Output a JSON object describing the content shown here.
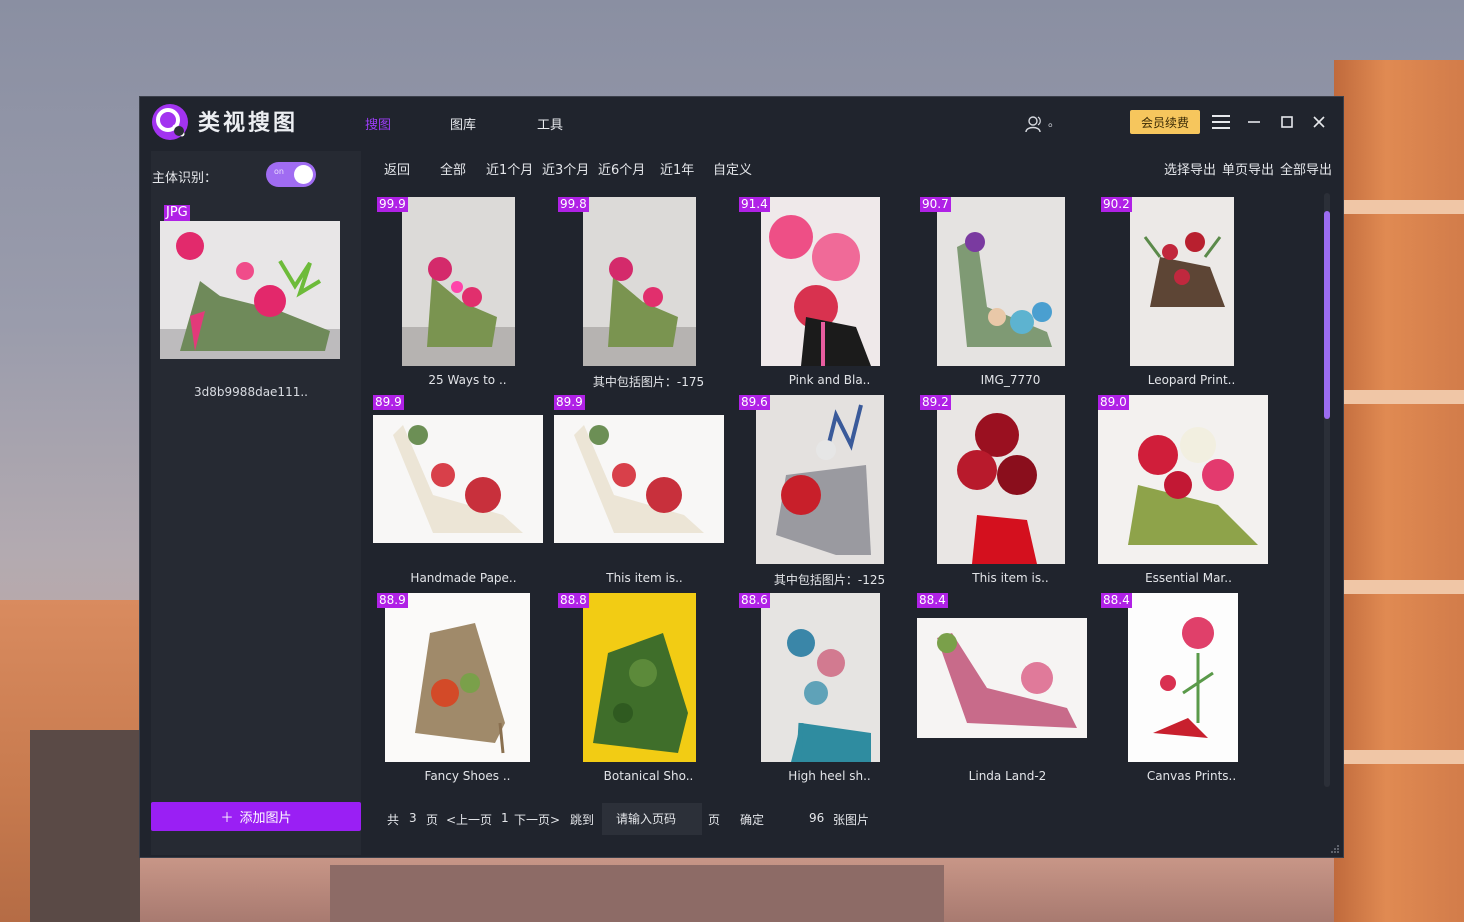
{
  "app": {
    "name": "类视搜图"
  },
  "nav": {
    "tabs": [
      {
        "label": "搜图",
        "active": true
      },
      {
        "label": "图库",
        "active": false
      },
      {
        "label": "工具",
        "active": false
      }
    ]
  },
  "header": {
    "user_suffix": "。",
    "vip_label": "会员续费"
  },
  "sidebar": {
    "subject_label": "主体识别：",
    "toggle_text": "on",
    "toggle_on": true,
    "query_badge": "JPG",
    "query_name": "3d8b9988dae111..",
    "add_button": "添加图片"
  },
  "filters": [
    {
      "label": "返回"
    },
    {
      "label": "全部"
    },
    {
      "label": "近1个月"
    },
    {
      "label": "近3个月"
    },
    {
      "label": "近6个月"
    },
    {
      "label": "近1年"
    },
    {
      "label": "自定义"
    }
  ],
  "exports": [
    {
      "label": "选择导出"
    },
    {
      "label": "单页导出"
    },
    {
      "label": "全部导出"
    }
  ],
  "results": [
    {
      "score": "99.9",
      "caption": "25 Ways to .."
    },
    {
      "score": "99.8",
      "caption": "其中包括图片：-175"
    },
    {
      "score": "91.4",
      "caption": "Pink and Bla.."
    },
    {
      "score": "90.7",
      "caption": "IMG_7770"
    },
    {
      "score": "90.2",
      "caption": "Leopard Print.."
    },
    {
      "score": "89.9",
      "caption": "Handmade Pape.."
    },
    {
      "score": "89.9",
      "caption": "This item is.."
    },
    {
      "score": "89.6",
      "caption": "其中包括图片：-125"
    },
    {
      "score": "89.2",
      "caption": "This item is.."
    },
    {
      "score": "89.0",
      "caption": "Essential Mar.."
    },
    {
      "score": "88.9",
      "caption": "Fancy Shoes .."
    },
    {
      "score": "88.8",
      "caption": "Botanical Sho.."
    },
    {
      "score": "88.6",
      "caption": "High heel sh.."
    },
    {
      "score": "88.4",
      "caption": "Linda Land-2"
    },
    {
      "score": "88.4",
      "caption": "Canvas Prints.."
    }
  ],
  "pager": {
    "total_prefix": "共",
    "total_pages": "3",
    "page_unit": "页",
    "prev": "<上一页",
    "current": "1",
    "next": "下一页>",
    "jump": "跳到",
    "input_placeholder": "请输入页码",
    "page_suffix": "页",
    "confirm": "确定",
    "total_images": "96",
    "images_unit": "张图片"
  }
}
